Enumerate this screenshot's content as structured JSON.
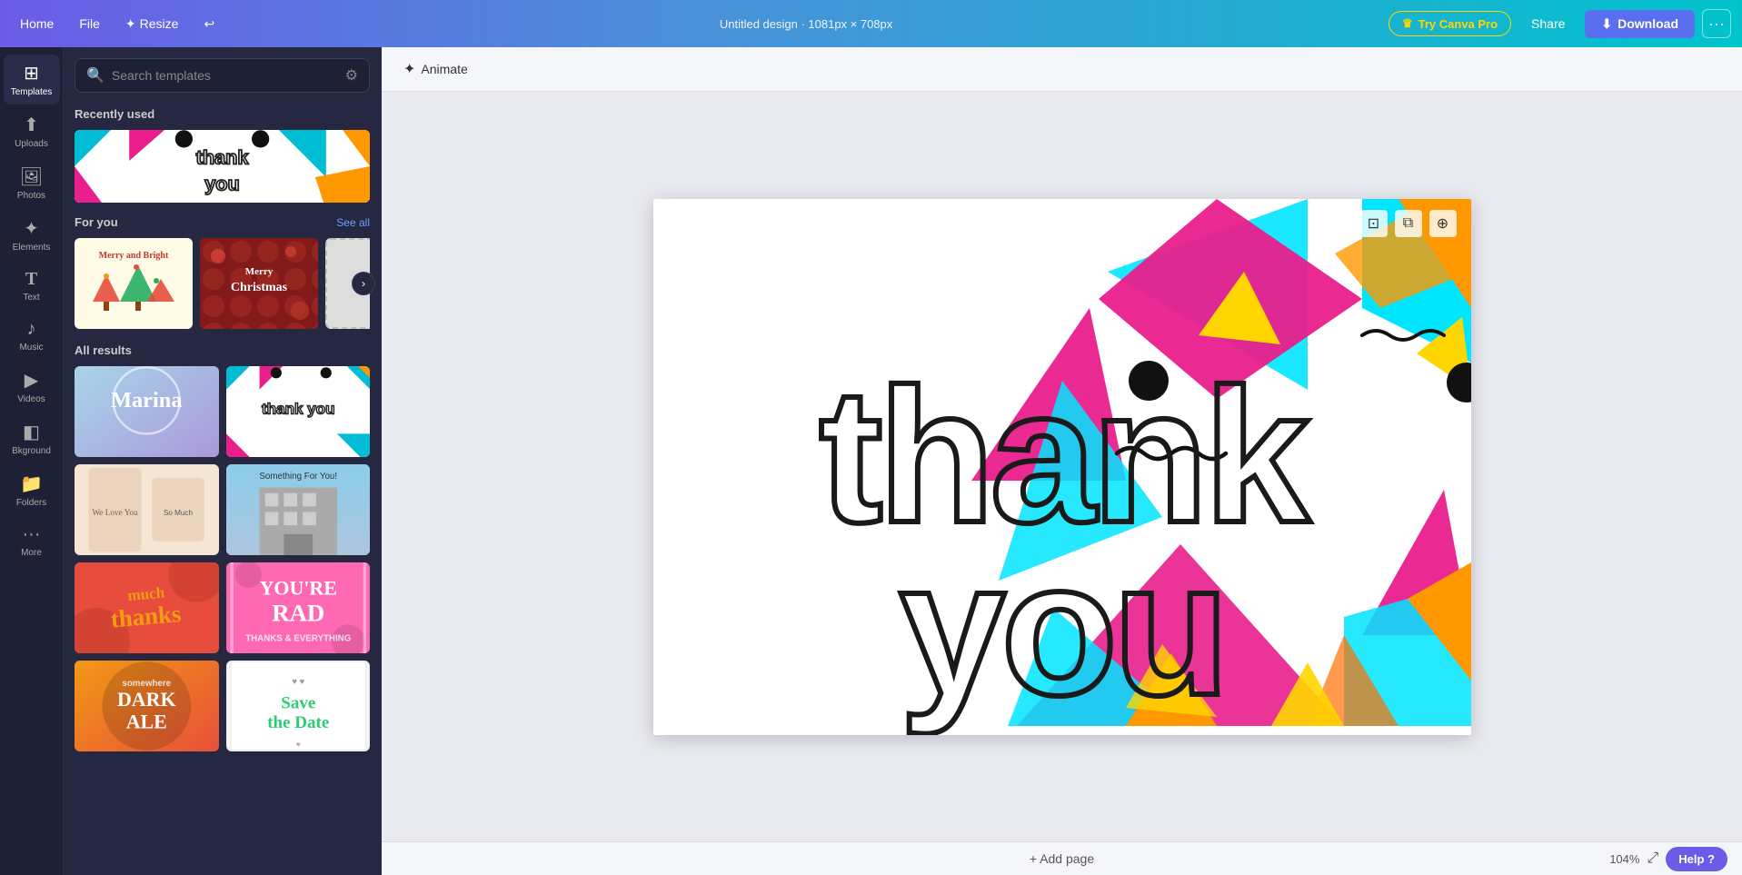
{
  "topbar": {
    "home_label": "Home",
    "file_label": "File",
    "resize_label": "Resize",
    "undo_label": "↩",
    "title": "Untitled design · 1081px × 708px",
    "try_canva_label": "Try Canva Pro",
    "share_label": "Share",
    "download_label": "Download",
    "more_label": "···"
  },
  "sidebar": {
    "items": [
      {
        "id": "templates",
        "label": "Templates",
        "icon": "⊞"
      },
      {
        "id": "uploads",
        "label": "Uploads",
        "icon": "↑"
      },
      {
        "id": "photos",
        "label": "Photos",
        "icon": "🖼"
      },
      {
        "id": "elements",
        "label": "Elements",
        "icon": "✦"
      },
      {
        "id": "text",
        "label": "Text",
        "icon": "T"
      },
      {
        "id": "music",
        "label": "Music",
        "icon": "♪"
      },
      {
        "id": "videos",
        "label": "Videos",
        "icon": "▶"
      },
      {
        "id": "background",
        "label": "Bkground",
        "icon": "◧"
      },
      {
        "id": "folders",
        "label": "Folders",
        "icon": "📁"
      },
      {
        "id": "more",
        "label": "More",
        "icon": "···"
      }
    ]
  },
  "templates_panel": {
    "search_placeholder": "Search templates",
    "recently_used_label": "Recently used",
    "for_you_label": "For you",
    "see_all_label": "See all",
    "all_results_label": "All results",
    "templates": [
      {
        "id": "recent1",
        "label": "thank you colorful",
        "type": "single"
      },
      {
        "id": "foryou1",
        "label": "Merry and Bright",
        "bg": "#fffbe6",
        "textColor": "#c0392b"
      },
      {
        "id": "foryou2",
        "label": "Merry Christmas",
        "bg": "#c0392b",
        "textColor": "white"
      },
      {
        "id": "result1",
        "label": "Marina",
        "type": "grid"
      },
      {
        "id": "result2",
        "label": "thank you",
        "type": "grid"
      },
      {
        "id": "result3",
        "label": "We Love You",
        "type": "grid"
      },
      {
        "id": "result4",
        "label": "Something For You",
        "type": "grid"
      },
      {
        "id": "result5",
        "label": "much thanks",
        "type": "grid"
      },
      {
        "id": "result6",
        "label": "YOU'RE RAD",
        "type": "grid"
      },
      {
        "id": "result7",
        "label": "DARK ALE",
        "type": "grid"
      },
      {
        "id": "result8",
        "label": "Save the Date",
        "type": "grid"
      }
    ]
  },
  "canvas": {
    "animate_label": "Animate",
    "add_page_label": "+ Add page",
    "zoom_level": "104%",
    "help_label": "Help ?",
    "design_text_line1": "thank",
    "design_text_line2": "you"
  }
}
